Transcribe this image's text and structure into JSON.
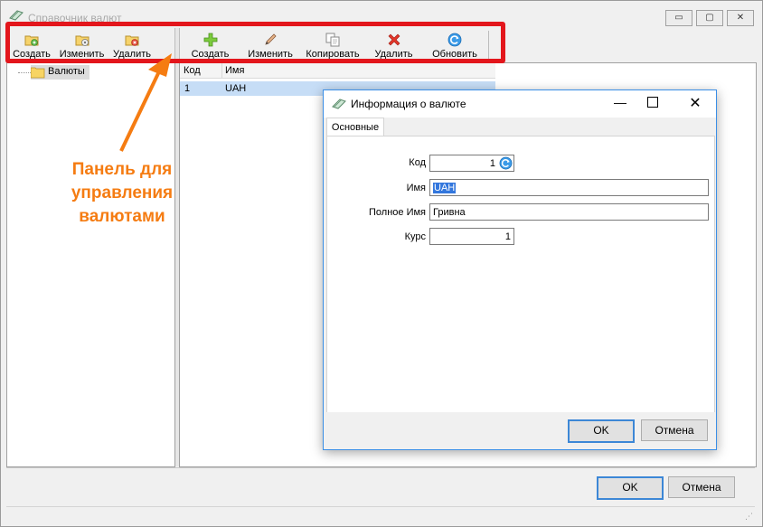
{
  "main_window": {
    "title": "Справочник валют",
    "minimize_glyph": "▭",
    "maximize_glyph": "▢",
    "close_glyph": "✕"
  },
  "left_toolbar": {
    "buttons": [
      {
        "label": "Создать",
        "icon": "folder-add-icon"
      },
      {
        "label": "Изменить",
        "icon": "folder-edit-icon"
      },
      {
        "label": "Удалить",
        "icon": "folder-delete-icon"
      }
    ]
  },
  "right_toolbar": {
    "buttons": [
      {
        "label": "Создать",
        "icon": "plus-icon"
      },
      {
        "label": "Изменить",
        "icon": "pencil-icon"
      },
      {
        "label": "Копировать",
        "icon": "copy-icon"
      },
      {
        "label": "Удалить",
        "icon": "red-x-icon"
      },
      {
        "label": "Обновить",
        "icon": "refresh-icon"
      }
    ]
  },
  "tree": {
    "root_label": "Валюты"
  },
  "grid": {
    "columns": [
      "Код",
      "Имя"
    ],
    "rows": [
      {
        "code": "1",
        "name": "UAH"
      }
    ]
  },
  "annotation": {
    "line1": "Панель для",
    "line2": "управления",
    "line3": "валютами"
  },
  "main_footer": {
    "ok_label": "OK",
    "cancel_label": "Отмена"
  },
  "dialog": {
    "title": "Информация о валюте",
    "tab_label": "Основные",
    "fields": {
      "code_label": "Код",
      "code_value": "1",
      "name_label": "Имя",
      "name_value": "UAH",
      "fullname_label": "Полное Имя",
      "fullname_value": "Гривна",
      "rate_label": "Курс",
      "rate_value": "1"
    },
    "ok_label": "OK",
    "cancel_label": "Отмена",
    "minimize_glyph": "—",
    "close_glyph": "✕"
  },
  "colors": {
    "annotation_red": "#e3161c",
    "annotation_orange": "#f57c12",
    "selection": "#c6ddf6",
    "accent_blue": "#3a8ee6"
  }
}
